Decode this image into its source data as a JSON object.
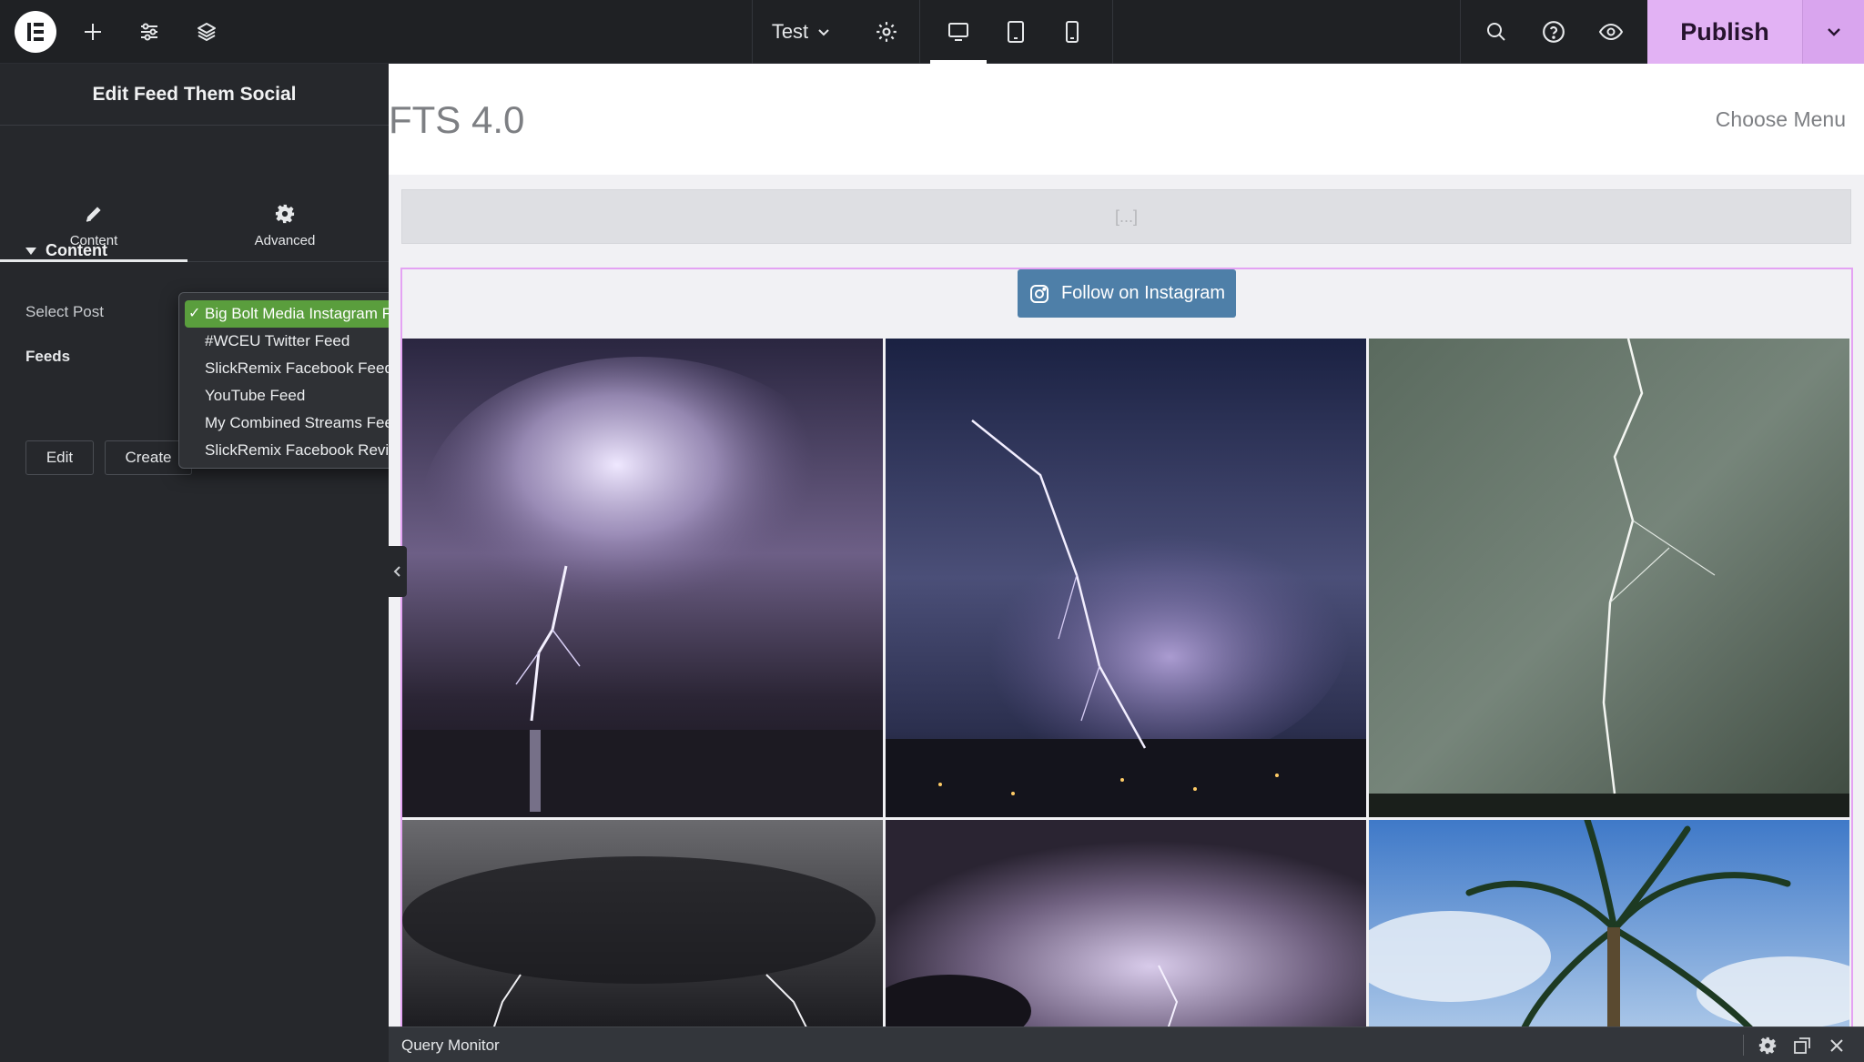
{
  "topbar": {
    "document_title": "Test",
    "publish_label": "Publish",
    "icons": [
      "elementor-logo-icon",
      "plus-icon",
      "sliders-icon",
      "layers-icon",
      "chevron-down-icon",
      "gear-icon",
      "desktop-icon",
      "tablet-icon",
      "mobile-icon",
      "search-icon",
      "help-icon",
      "eye-icon",
      "chevron-down-icon"
    ],
    "accent_color": "#e2b2f4"
  },
  "panel": {
    "title": "Edit Feed Them Social",
    "tabs": [
      {
        "label": "Content",
        "icon": "pencil-icon",
        "active": true
      },
      {
        "label": "Advanced",
        "icon": "gear-icon",
        "active": false
      }
    ],
    "section_title": "Content",
    "select_post_label": "Select Post",
    "feeds_label": "Feeds",
    "edit_button": "Edit",
    "create_button": "Create"
  },
  "dropdown": {
    "options": [
      {
        "label": "Big Bolt Media Instagram Feed",
        "selected": true
      },
      {
        "label": "#WCEU Twitter Feed",
        "selected": false
      },
      {
        "label": "SlickRemix Facebook Feed",
        "selected": false
      },
      {
        "label": "YouTube Feed",
        "selected": false
      },
      {
        "label": "My Combined Streams Feed",
        "selected": false
      },
      {
        "label": "SlickRemix Facebook Reviews",
        "selected": false
      }
    ],
    "selected_color": "#5a9e3d"
  },
  "canvas": {
    "site_title": "FTS 4.0",
    "menu_label": "Choose Menu",
    "placeholder_text": "[...]",
    "follow_button": "Follow on Instagram",
    "follow_icon": "instagram-icon"
  },
  "query_monitor": {
    "title": "Query Monitor",
    "icons": [
      "gear-icon",
      "popout-icon",
      "close-icon"
    ]
  }
}
